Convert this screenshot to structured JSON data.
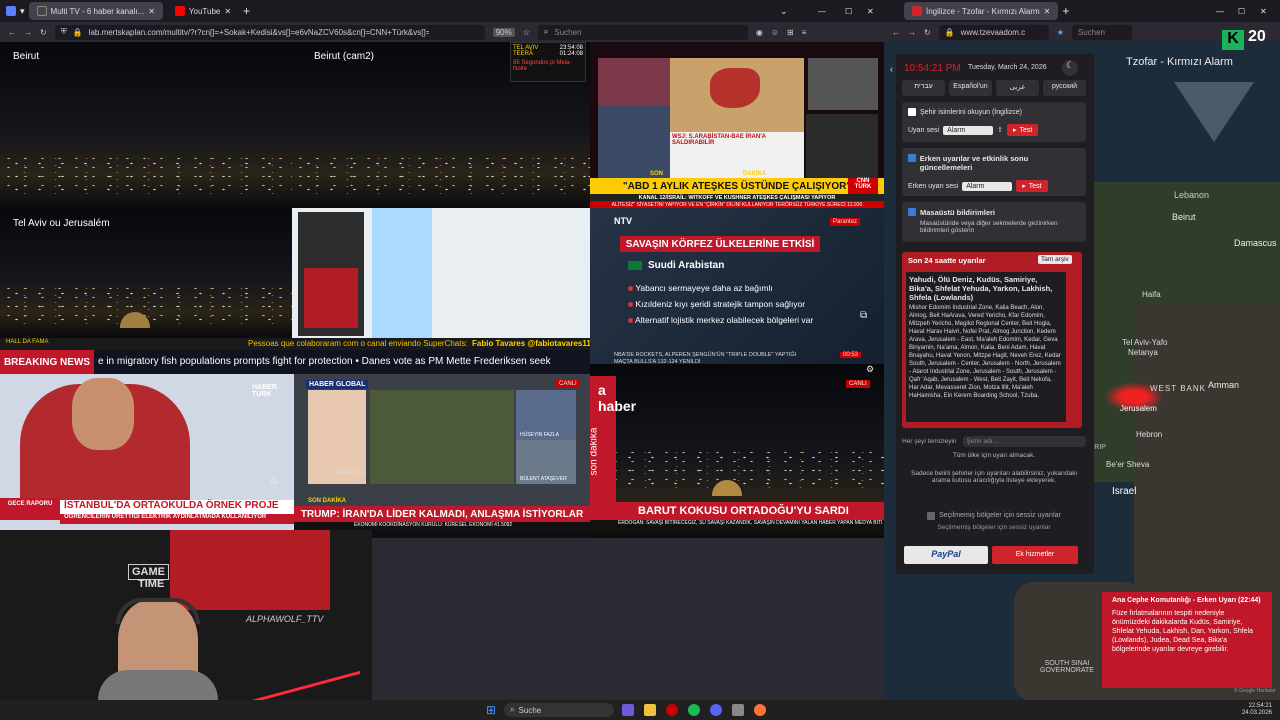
{
  "left_browser": {
    "tabs": [
      {
        "label": "Multi TV - 6 haber kanalı..."
      },
      {
        "label": "YouTube"
      }
    ],
    "url": "lab.mertskaplan.com/multitv/?r?cn[]=+Sokak+Kedisi&vs[]=e6vNaZCV60s&cn[]=CNN+Türk&vs[]=6N8_r2uw...",
    "zoom": "90%",
    "search_placeholder": "Suchen"
  },
  "cells": {
    "cam1_label": "Beirut",
    "cam2_label": "Beirut (cam2)",
    "cam3_label": "Tel Aviv ou Jerusalém",
    "clock": {
      "city1": "TEL AVIV",
      "time1": "23:54:08",
      "city2": "TEERÃ",
      "time2": "01:24:08",
      "caption": "95 Segundos pi Meia-Noite"
    },
    "cnn": {
      "top": "SON",
      "top2": "DAKİKA",
      "canli": "CANLI",
      "headline": "\"ABD 1 AYLIK ATEŞKES ÜSTÜNDE ÇALIŞIYOR\"",
      "sub": "KANAL 12/İSRAİL: WITKOFF VE KUSHNER ATEŞKES ÇALIŞMASI YAPIYOR",
      "ticker": "ALİTESİZ\" SİYASETİNİ YAPIYOR VE EN \"ÇİRKİN\" DİLİNİ KULLANIYOR  TERÖRSÜZ TÜRKİYE SÜRECİ  12.930",
      "side_title": "WSJ: S.ARABİSTAN-BAE İRAN'A SALDIRABİLİR",
      "side_logo": "CNN TÜRK"
    },
    "ntv": {
      "logo": "NTV",
      "title": "SAVAŞIN KÖRFEZ ÜLKELERİNE ETKİSİ",
      "country": "Suudi Arabistan",
      "bullets": [
        "Yabancı sermayeye daha az bağımlı",
        "Kızıldeniz kıyı şeridi stratejik tampon sağlıyor",
        "Alternatif lojistik merkez olabilecek bölgeleri var"
      ],
      "footer": "NBA'DE ROCKETS, ALPEREN ŞENGÜN'ÜN \"TRIPLE DOUBLE\" YAPTIĞI MAÇTA BULLS'A 132-124 YENİLDİ",
      "time": "00:53",
      "badge": "Parantez"
    },
    "superchat": {
      "left": "HALL DA FAMA",
      "text": "Pessoas que colaboraram com o canal enviando SuperChats:",
      "name": "Fabio Tavares @fabiotavares11630"
    },
    "breaking": {
      "label": "BREAKING NEWS",
      "text": "e in migratory fish populations prompts fight for protection  •  Danes vote as PM Mette Frederiksen seek"
    },
    "haberturk": {
      "logo": "HABER TÜRK",
      "badge": "GECE RAPORU",
      "headline": "İSTANBUL'DA ORTAOKULDA ÖRNEK PROJE",
      "sub": "ÖĞRENCİLERİN ÜRETTİĞİ ELEKTRİK AYDINLATMADA KULLANILIYOR"
    },
    "haberglobal": {
      "logo": "HABER GLOBAL",
      "canli": "CANLI",
      "p1": "HÜSEYİN FAZLA",
      "p2": "BÜLENT ATAŞEVER",
      "anchor": "DİLARA KILIÇ",
      "son": "SON DAKİKA",
      "headline": "TRUMP: İRAN'DA LİDER KALMADI, ANLAŞMA İSTİYORLAR",
      "ticker": "EKONOMİ KOORDİNASYON KURULU: KÜRESEL EKONOMİ  41.5092"
    },
    "ahaber": {
      "logo": "a haber",
      "side": "son dakika",
      "canli": "CANLI",
      "headline": "BARUT KOKUSU ORTADOĞU'YU SARDI",
      "ticker": "ERDOĞAN: SAVAŞI BİTİRECEĞİZ, SU SAVAŞI KAZANDIK, SAVAŞIN DEVAMINI YALAN HABER YAPAN MEDYA BİTİ",
      "time": "00:53"
    },
    "stream": {
      "sign1": "GAME",
      "sign2": "TIME",
      "sign3": "ALPHAWOLF_TTV"
    }
  },
  "right_browser": {
    "tab": "İngilizce - Tzofar - Kırmızı Alarm",
    "url": "www.tzevaadom.c",
    "search": "Suchen",
    "clock": "10:54:21 PM",
    "date": "Tuesday, March 24, 2026",
    "languages": [
      "עברית",
      "Español'un",
      "عربى",
      "русский"
    ],
    "read_city": "Şehir isimlerini okuyun (İngilizce)",
    "alarm_sound_label": "Uyarı sesi",
    "alarm_select": "Alarm",
    "test": "Test",
    "early_title": "Erken uyarılar ve etkinlik sonu güncellemeleri",
    "early_sound_label": "Erken uyarı sesi",
    "desktop_title": "Masaüstü bildirimleri",
    "desktop_desc": "Masaüstünde veya diğer sekmelerde gezinirken bildirimleri gösterin",
    "last24": "Son 24 saatte uyarılar",
    "archive": "Tam arşiv",
    "alert_bold": "Yahudi, Ölü Deniz, Kudüs, Samiriye, Bika'a, Shfelat Yehuda, Yarkon, Lakhish, Shfela (Lowlands)",
    "alert_body": "Mishor Edomim Industrial Zone, Kalia Beach, Alon, Almog, Beit HaArava, Vered Yericho, Kfar Edomim, Mitzpeh Yericho, Megilot Regional Center, Beit Hogla, Havat Harav Haivri, Nofei Prat, Almog Junction, Kedem Arava, Jerusalem - East, Ma'aleh Edomim, Kedar, Geva Binyamin, Na'ama, Almon, Kalia, Beni Adam, Havat Bnayahu, Havat Yenon, Mitzpe Hagit, Neveh Erez, Kedar South, Jerusalem - Center, Jerusalem - North, Jerusalem - Atarot Industrial Zone, Jerusalem - South, Jerusalem - Qafr 'Aqab, Jerusalem - West, Beit Zayit, Beit Nekofa, Har Adar, Mevasseret Zion, Motza Illit, Ma'aleh HaHamisha, Ein Kerem Boarding School, Tzuba,",
    "filter_placeholder": "Her şeyi temizleyin",
    "search_placeholder": "Şehir adı...",
    "all_cities": "Tüm ülke için uyarı almacak.",
    "filter_desc": "Sadece belirli şehirler için uyarıları alabilirsiniz, yukarıdaki arama kutusu aracılığıyla listeye ekleyerek.",
    "silent_title": "Seçilmemiş bölgeler için sessiz uyarılar",
    "silent_desc": "Seçilmemiş bölgeler için sessiz uyarılar",
    "paypal": "PayPal",
    "donate": "Ek hizmetler",
    "tzofar": "Tzofar - Kırmızı Alarm",
    "badge20": "20",
    "map_labels": {
      "lebanon": "Lebanon",
      "beirut": "Beirut",
      "damascus": "Damascus",
      "haifa": "Haifa",
      "netanya": "Netanya",
      "telaviv": "Tel Aviv-Yafo",
      "westbank": "WEST BANK",
      "amman": "Amman",
      "jerusalem": "Jerusalem",
      "hebron": "Hebron",
      "beersheva": "Be'er Sheva",
      "israel": "Israel",
      "sinai": "SOUTH SINAI GOVERNORATE",
      "strip": "TRIP",
      "credit": "© Google Haritalar"
    },
    "toast_title": "Ana Cephe Komutanlığı - Erken Uyarı (22:44)",
    "toast_body": "Füze fırlatmalarının tespiti nedeniyle önümüzdeki dakikalarda Kudüs, Samiriye, Shfelat Yehuda, Lakhish, Dan, Yarkon, Shfela (Lowlands), Judea, Dead Sea, Bika'a bölgelerinde uyarılar devreye girebilir."
  },
  "taskbar": {
    "search": "Suche",
    "time": "22:54:21",
    "date": "24.03.2026"
  }
}
